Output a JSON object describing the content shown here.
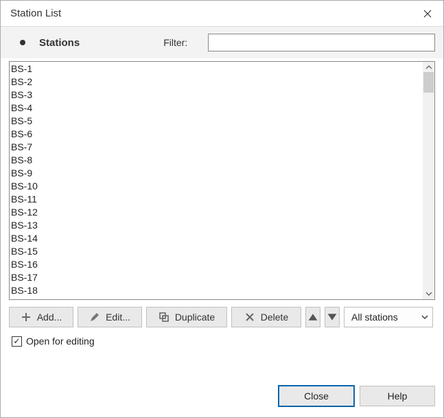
{
  "window": {
    "title": "Station List"
  },
  "header": {
    "heading": "Stations",
    "filter_label": "Filter:",
    "filter_value": ""
  },
  "stations": [
    "BS-1",
    "BS-2",
    "BS-3",
    "BS-4",
    "BS-5",
    "BS-6",
    "BS-7",
    "BS-8",
    "BS-9",
    "BS-10",
    "BS-11",
    "BS-12",
    "BS-13",
    "BS-14",
    "BS-15",
    "BS-16",
    "BS-17",
    "BS-18"
  ],
  "toolbar": {
    "add": "Add...",
    "edit": "Edit...",
    "duplicate": "Duplicate",
    "delete": "Delete",
    "filter_select": "All stations"
  },
  "options": {
    "open_for_editing_label": "Open for editing",
    "open_for_editing_checked": true
  },
  "footer": {
    "close": "Close",
    "help": "Help"
  }
}
